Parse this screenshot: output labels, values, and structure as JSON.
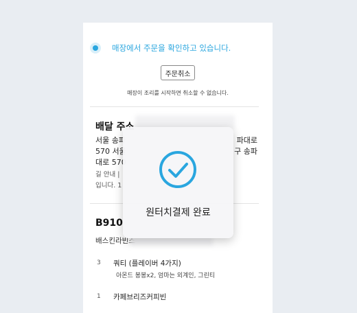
{
  "order": {
    "status_text": "매장에서 주문을 확인하고 있습니다.",
    "cancel_button": "주문취소",
    "cancel_note": "매장이 조리를 시작하면 취소할 수 없습니다."
  },
  "delivery": {
    "title": "배달 주소",
    "address_lines": [
      "서울 송파",
      "파대로",
      "570 서울",
      "구 송파",
      "대로 570"
    ],
    "guide_lines": [
      "길 안내 |",
      "입니다. 1"
    ]
  },
  "detail": {
    "order_number": "B910",
    "store_name": "배스킨라빈스 ",
    "items": [
      {
        "qty": "3",
        "name": "쿼티 (플레이버 4가지)",
        "options": "아몬드 봉봉x2, 엄마는 외계인, 그린티"
      },
      {
        "qty": "1",
        "name": "카페브리즈커피빈",
        "options": ""
      }
    ]
  },
  "toast": {
    "message": "원터치결제 완료",
    "icon": "check-circle-icon",
    "accent_color": "#2aa6df"
  },
  "colors": {
    "background": "#e9edf2",
    "card": "#ffffff",
    "accent": "#2aa6df"
  }
}
